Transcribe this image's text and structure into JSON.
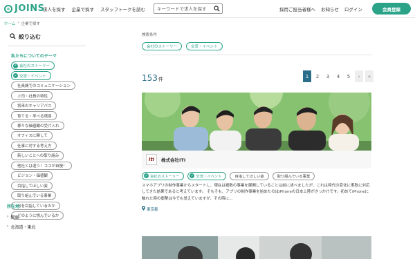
{
  "header": {
    "logo_text": "JOINS",
    "nav_left": [
      "求人を探す",
      "企業で探す",
      "スタッフトークを読む"
    ],
    "search_placeholder": "キーワードで求人を探す",
    "nav_right": [
      "採用ご担当者様へ",
      "お知らせ",
      "ログイン"
    ],
    "register_label": "会員登録",
    "brand_color": "#2ba389"
  },
  "breadcrumb": {
    "home": "ホーム",
    "separator": "›",
    "current": "企業で探す"
  },
  "sidebar": {
    "filter_title": "絞り込む",
    "theme_title": "私たちについてのテーマ",
    "themes": [
      {
        "label": "会社のストーリー",
        "selected": true
      },
      {
        "label": "交流・イベント",
        "selected": true
      },
      {
        "label": "社員間でのコミュニケーション",
        "selected": false
      },
      {
        "label": "上司・社員の特性",
        "selected": false
      },
      {
        "label": "将来のキャリアパス",
        "selected": false
      },
      {
        "label": "育てる・学べる環境",
        "selected": false
      },
      {
        "label": "様々な価値観の受け入れ",
        "selected": false
      },
      {
        "label": "オフィスに関して",
        "selected": false
      },
      {
        "label": "仕事に対する考え方",
        "selected": false
      },
      {
        "label": "新しいことへの取り組み",
        "selected": false
      },
      {
        "label": "他社とは違う！ココが自慢！",
        "selected": false
      },
      {
        "label": "ビジョン・価値観",
        "selected": false
      },
      {
        "label": "目指してほしい姿",
        "selected": false
      },
      {
        "label": "取り組んでいる事業",
        "selected": false
      },
      {
        "label": "何を目指しているのか",
        "selected": false
      },
      {
        "label": "どのように挑んでいるか",
        "selected": false
      }
    ],
    "location_title": "所在地",
    "locations": [
      "関東",
      "北海道・東北"
    ]
  },
  "main": {
    "conditions_label": "検索条件",
    "conditions": [
      "会社のストーリー",
      "交流・イベント"
    ],
    "count_value": "153",
    "count_unit": "件",
    "pages": [
      "1",
      "2",
      "3",
      "4",
      "5",
      "›",
      "»"
    ],
    "active_page": "1"
  },
  "card": {
    "company_logo_text": "iti",
    "company_name": "株式会社ITI",
    "tags": [
      {
        "label": "会社のストーリー",
        "selected": true
      },
      {
        "label": "交流・イベント",
        "selected": true
      },
      {
        "label": "目指してほしい姿",
        "selected": false
      },
      {
        "label": "取り組んでいる事業",
        "selected": false
      }
    ],
    "description": "スマホアプリの制作事業からスタートし、現在は複数の事業を展開していることは前に述べましたが、これは時代の変化に柔軟に対応してきた結果であると考えています。 そもそも、アプリの制作事業を始めたのはiPhoneの日本上陸がきっかけです。初めてiPhoneに触れた時の衝撃は今でも覚えていますが、その時に…",
    "location": "東京都"
  }
}
